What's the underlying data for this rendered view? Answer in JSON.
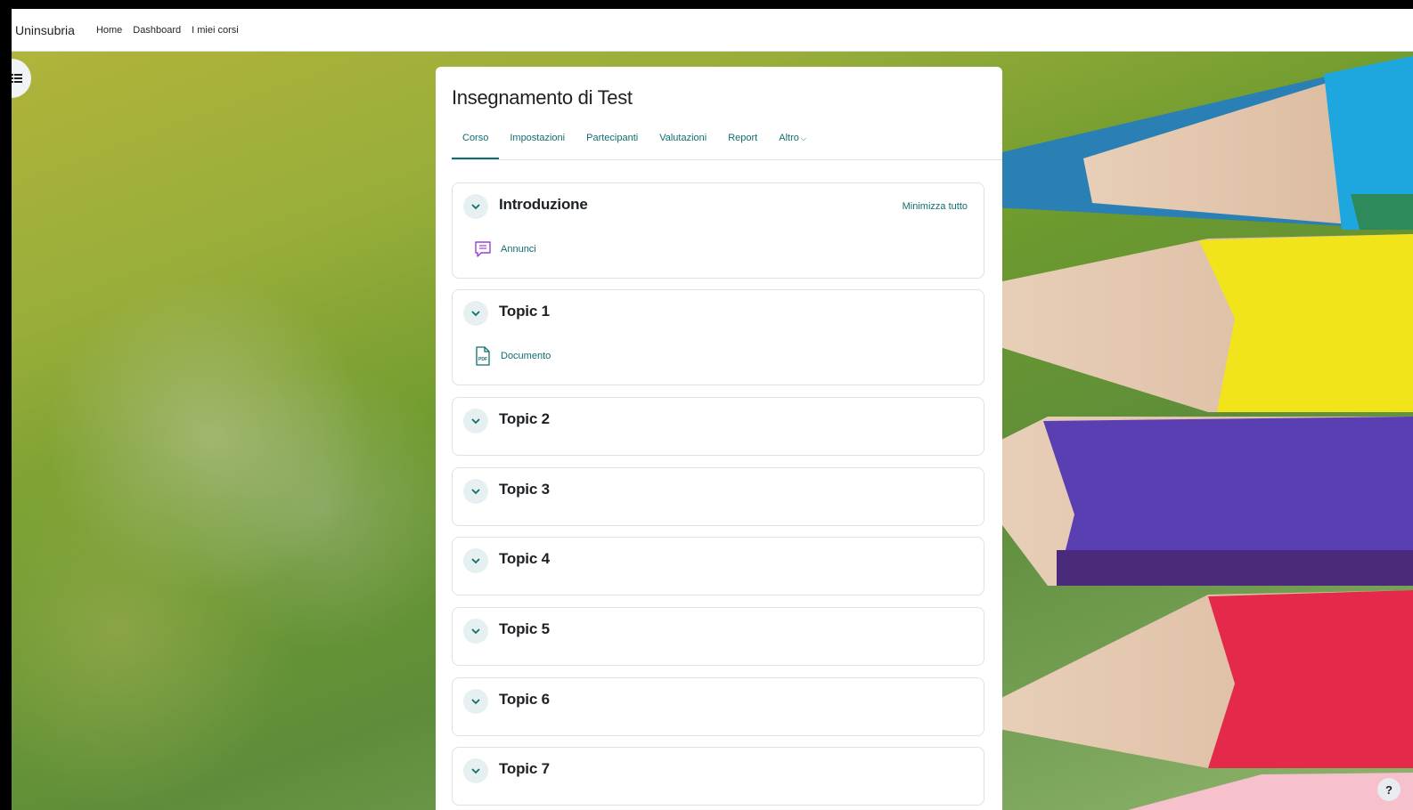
{
  "navbar": {
    "brand": "Uninsubria",
    "links": [
      "Home",
      "Dashboard",
      "I miei corsi"
    ]
  },
  "course": {
    "title": "Insegnamento di Test",
    "tabs": [
      "Corso",
      "Impostazioni",
      "Partecipanti",
      "Valutazioni",
      "Report",
      "Altro"
    ],
    "active_tab": "Corso",
    "collapse_all": "Minimizza tutto",
    "sections": [
      {
        "title": "Introduzione",
        "activity": {
          "label": "Annunci",
          "icon": "forum-icon"
        }
      },
      {
        "title": "Topic 1",
        "activity": {
          "label": "Documento",
          "icon": "pdf-icon"
        }
      },
      {
        "title": "Topic 2"
      },
      {
        "title": "Topic 3"
      },
      {
        "title": "Topic 4"
      },
      {
        "title": "Topic 5"
      },
      {
        "title": "Topic 6"
      },
      {
        "title": "Topic 7"
      }
    ]
  },
  "help": {
    "label": "?"
  },
  "colors": {
    "accent": "#0f6e6e",
    "forum_icon": "#9b3fd6",
    "pdf_icon": "#0f6e6e"
  }
}
